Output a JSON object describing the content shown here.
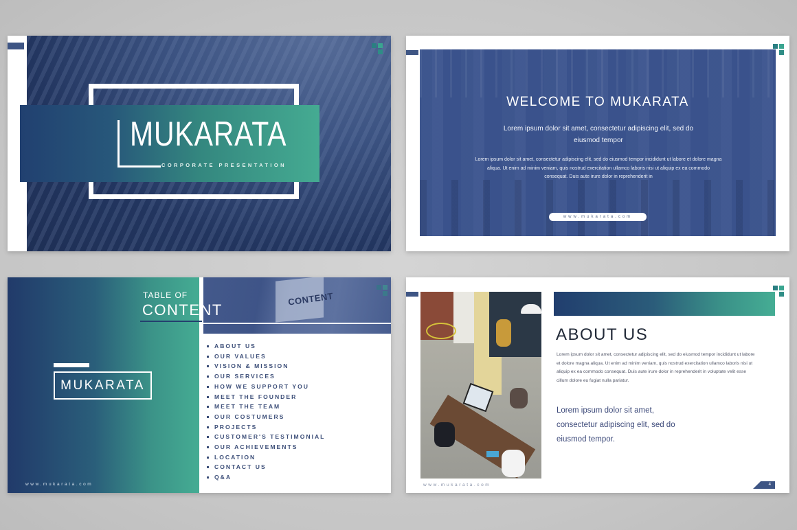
{
  "colors": {
    "navy": "#213a6a",
    "teal": "#45ac93",
    "slate_blue": "#3e5584",
    "text_blue": "#3c4e78",
    "background": "#c8c8c8"
  },
  "slides": [
    {
      "id": "cover",
      "title": "MUKARATA",
      "subtitle": "CORPORATE PRESENTATION",
      "logo_icon": "squares-logo-icon"
    },
    {
      "id": "welcome",
      "heading": "WELCOME TO MUKARATA",
      "lead": "Lorem ipsum dolor sit amet, consectetur adipiscing elit, sed do eiusmod tempor",
      "body": "Lorem ipsum dolor sit amet, consectetur adipiscing elit, sed do eiusmod tempor incididunt ut labore et dolore magna aliqua. Ut enim ad minim veniam, quis nostrud exercitation ullamco laboris nisi ut aliquip ex ea commodo consequat. Duis aute irure dolor in reprehenderit in",
      "url": "www.mukarata.com",
      "logo_icon": "squares-logo-icon"
    },
    {
      "id": "table-of-content",
      "heading_small": "TABLE OF",
      "heading_big": "CONTENT",
      "hero_word": "CONTENT",
      "brand": "MUKARATA",
      "url": "www.mukarata.com",
      "items": [
        "ABOUT US",
        "OUR VALUES",
        "VISION & MISSION",
        "OUR SERVICES",
        "HOW WE SUPPORT YOU",
        "MEET THE FOUNDER",
        "MEET THE TEAM",
        "OUR COSTUMERS",
        "PROJECTS",
        "CUSTOMER'S TESTIMONIAL",
        "OUR ACHIEVEMENTS",
        "LOCATION",
        "CONTACT US",
        "Q&A"
      ],
      "logo_icon": "squares-logo-icon"
    },
    {
      "id": "about-us",
      "heading": "ABOUT US",
      "body": "Lorem ipsum dolor sit amet, consectetur adipiscing elit, sed do eiusmod tempor incididunt ut labore et dolore magna aliqua. Ut enim ad minim veniam, quis nostrud exercitation ullamco laboris nisi ut aliquip ex ea commodo consequat. Duis aute irure dolor in reprehenderit in voluptate velit esse cillum dolore eu fugiat nulla pariatur.",
      "lead": "Lorem ipsum dolor sit amet, consectetur adipiscing elit, sed do eiusmod tempor.",
      "url": "www.mukarata.com",
      "page_number": "4",
      "logo_icon": "squares-logo-icon"
    }
  ]
}
